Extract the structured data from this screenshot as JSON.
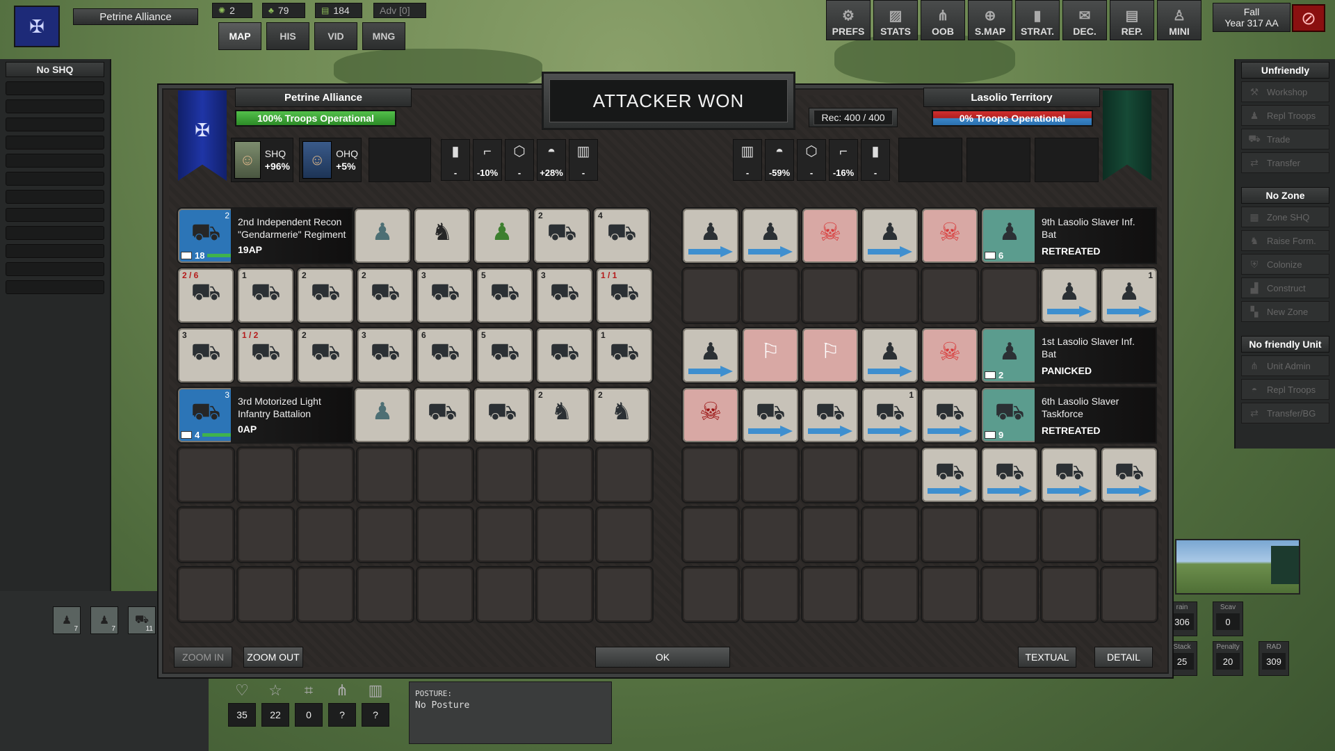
{
  "topbar": {
    "faction_name": "Petrine Alliance",
    "res_1": "2",
    "res_2": "79",
    "res_3": "184",
    "adv": "Adv [0]",
    "nav_tabs": [
      "MAP",
      "HIS",
      "VID",
      "MNG"
    ],
    "buttons": [
      "PREFS",
      "STATS",
      "OOB",
      "S.MAP",
      "STRAT.",
      "DEC.",
      "REP.",
      "MINI"
    ],
    "season": "Fall",
    "year": "Year 317 AA"
  },
  "left_panel": {
    "header": "No SHQ"
  },
  "right_panel": {
    "header_1": "Unfriendly",
    "items_1": [
      "Workshop",
      "Repl Troops",
      "Trade",
      "Transfer"
    ],
    "header_2": "No Zone",
    "items_2": [
      "Zone SHQ",
      "Raise Form.",
      "Colonize",
      "Construct",
      "New Zone"
    ],
    "header_3": "No friendly Unit",
    "items_3": [
      "Unit Admin",
      "Repl Troops",
      "Transfer/BG"
    ]
  },
  "dialog": {
    "result": "ATTACKER WON",
    "attacker": {
      "name": "Petrine Alliance",
      "troops": "100% Troops Operational",
      "shq_label": "SHQ",
      "shq_value": "+96%",
      "ohq_label": "OHQ",
      "ohq_value": "+5%",
      "mods": [
        "-",
        "-10%",
        "-",
        "+28%",
        "-"
      ]
    },
    "defender": {
      "name": "Lasolio Territory",
      "troops": "0% Troops Operational",
      "rec": "Rec: 400 / 400",
      "mods": [
        "-",
        "-59%",
        "-",
        "-16%",
        "-"
      ]
    },
    "att_units": [
      {
        "name": "2nd Independent Recon \"Gendarmerie\" Regiment",
        "ap": "19AP",
        "hq_num": "2",
        "hq_count": "18"
      },
      {
        "name": "3rd Motorized Light Infantry Battalion",
        "ap": "0AP",
        "hq_num": "3",
        "hq_count": "4"
      }
    ],
    "def_units": [
      {
        "name": "9th Lasolio Slaver Inf. Bat",
        "status": "RETREATED",
        "hq_count": "6"
      },
      {
        "name": "1st Lasolio Slaver Inf. Bat",
        "status": "PANICKED",
        "hq_count": "2"
      },
      {
        "name": "6th Lasolio Slaver Taskforce",
        "status": "RETREATED",
        "hq_count": "9"
      }
    ],
    "counts": {
      "r1": [
        "",
        "",
        "",
        "2",
        "4"
      ],
      "r2": [
        "2 / 6",
        "1",
        "2",
        "2",
        "3",
        "5",
        "3",
        "1 / 1"
      ],
      "r3": [
        "3",
        "1 / 2",
        "2",
        "3",
        "6",
        "5",
        "",
        "1"
      ],
      "r4": [
        "",
        "",
        "",
        "2",
        "2"
      ],
      "d2": [
        "",
        "1"
      ],
      "d4": [
        "",
        "",
        "",
        "1",
        ""
      ]
    },
    "buttons": {
      "zoom_in": "ZOOM IN",
      "zoom_out": "ZOOM OUT",
      "ok": "OK",
      "textual": "TEXTUAL",
      "detail": "DETAIL"
    }
  },
  "bottom": {
    "mini_counts": [
      "7",
      "7",
      "11"
    ],
    "stats": [
      "35",
      "22",
      "0",
      "?",
      "?"
    ],
    "posture_label": "POSTURE:",
    "posture_value": "No Posture",
    "rstats": [
      {
        "label": "rain",
        "value": "306"
      },
      {
        "label": "Scav",
        "value": "0"
      },
      {
        "label": "Stack",
        "value": "25"
      },
      {
        "label": "Penalty",
        "value": "20"
      },
      {
        "label": "RAD",
        "value": "309"
      }
    ]
  }
}
